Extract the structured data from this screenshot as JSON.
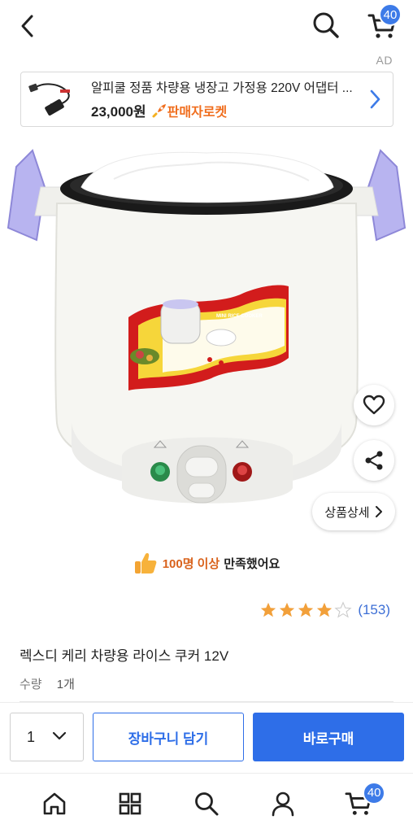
{
  "header": {
    "cart_count": "40"
  },
  "ad": {
    "label": "AD",
    "title": "알피쿨 정품 차량용 냉장고 가정용 220V 어댑터 ...",
    "price": "23,000원",
    "badge": "판매자로켓"
  },
  "product": {
    "image_caption": "MINI RICE COOKER",
    "detail_button": "상품상세",
    "satisfaction_count": "100명 이상",
    "satisfaction_text": "만족했어요",
    "rating": 4.5,
    "review_count": "(153)",
    "name": "렉스디 케리 차량용 라이스 쿠커 12V",
    "qty_label": "수량",
    "qty_value": "1개"
  },
  "actions": {
    "qty_selected": "1",
    "add_to_cart": "장바구니 담기",
    "buy_now": "바로구매"
  },
  "nav": {
    "items": [
      "home-icon",
      "category-icon",
      "search-icon",
      "my-icon",
      "cart-icon"
    ],
    "cart_count": "40"
  },
  "colors": {
    "accent": "#2e6ee8",
    "badge": "#3d7be8",
    "orange": "#d9621c",
    "star": "#f2a03a"
  }
}
